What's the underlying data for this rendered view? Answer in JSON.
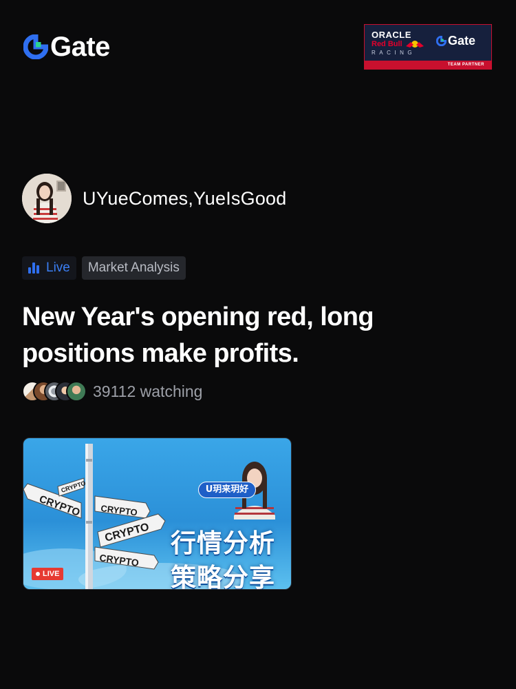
{
  "brand": {
    "name": "Gate",
    "color": "#ffffff",
    "accent": "#2f6ff0",
    "accent2": "#2bd48f"
  },
  "partner": {
    "line1": "ORACLE",
    "line2": "Red Bull",
    "line3": "RACING",
    "brand": "Gate",
    "strip": "TEAM PARTNER"
  },
  "host": {
    "name": "UYueComes,YueIsGood"
  },
  "tags": {
    "status": "Live",
    "category": "Market Analysis"
  },
  "stream": {
    "title": "New Year's opening red, long positions make profits.",
    "watching_count": "39112",
    "watching_label": "watching"
  },
  "thumbnail": {
    "host_label": "U玥来玥好",
    "headline_1": "行情分析",
    "headline_2": "策略分享",
    "badge": "LIVE",
    "sign_1": "CRYPTO",
    "sign_2": "CRYPTO",
    "sign_3": "CRYPTO",
    "sign_4": "CRYPTO",
    "sign_5": "CRYPTO"
  },
  "colors": {
    "background": "#0a0a0b",
    "live_blue": "#3b7ff5",
    "muted_text": "#9da0a8",
    "live_red": "#e63a32"
  }
}
